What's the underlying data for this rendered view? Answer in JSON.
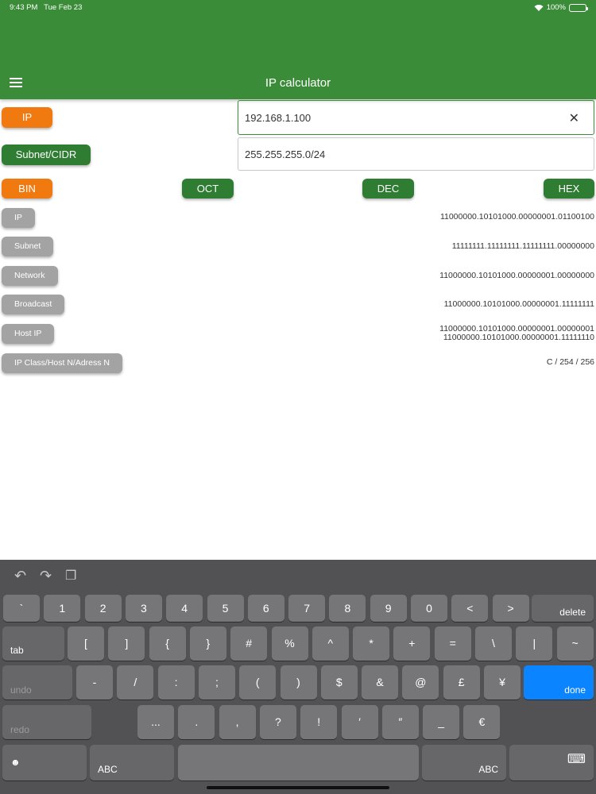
{
  "status": {
    "time": "9:43 PM",
    "date": "Tue Feb 23",
    "battery": "100%"
  },
  "header": {
    "title": "IP calculator",
    "menu_icon": "hamburger-icon"
  },
  "inputs": {
    "ip_label": "IP",
    "ip_value": "192.168.1.100",
    "subnet_label": "Subnet/CIDR",
    "subnet_value": "255.255.255.0/24"
  },
  "format_buttons": {
    "bin": "BIN",
    "oct": "OCT",
    "dec": "DEC",
    "hex": "HEX"
  },
  "rows": [
    {
      "label": "IP",
      "value": "11000000.10101000.00000001.01100100"
    },
    {
      "label": "Subnet",
      "value": "11111111.11111111.11111111.00000000"
    },
    {
      "label": "Network",
      "value": "11000000.10101000.00000001.00000000"
    },
    {
      "label": "Broadcast",
      "value": "11000000.10101000.00000001.11111111"
    },
    {
      "label": "Host IP",
      "value": "11000000.10101000.00000001.00000001",
      "value2": "11000000.10101000.00000001.11111110"
    },
    {
      "label": "IP Class/Host N/Adress N",
      "value": "C / 254 / 256"
    }
  ],
  "keyboard": {
    "row1": [
      "`",
      "1",
      "2",
      "3",
      "4",
      "5",
      "6",
      "7",
      "8",
      "9",
      "0",
      "<",
      ">"
    ],
    "delete": "delete",
    "tab": "tab",
    "row2": [
      "[",
      "]",
      "{",
      "}",
      "#",
      "%",
      "^",
      "*",
      "+",
      "=",
      "\\",
      "|",
      "~"
    ],
    "undo": "undo",
    "row3": [
      "-",
      "/",
      ":",
      ";",
      "(",
      ")",
      "$",
      "&",
      "@",
      "£",
      "¥"
    ],
    "done": "done",
    "redo": "redo",
    "row4": [
      "...",
      ".",
      ",",
      "?",
      "!",
      "′",
      "″",
      "_",
      "€"
    ],
    "emoji": "☻",
    "abc_left": "ABC",
    "abc_right": "ABC",
    "colors": {
      "accent": "#0a84ff",
      "header": "#3a8c38"
    }
  }
}
